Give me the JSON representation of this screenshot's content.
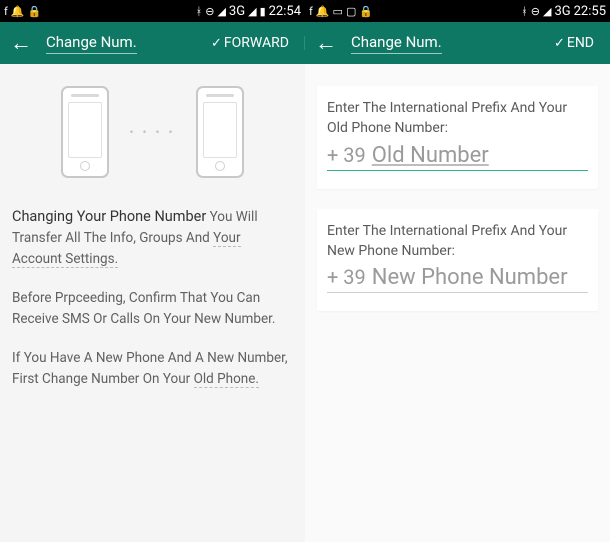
{
  "statusBar": {
    "left": {
      "signal": "3G",
      "time": "22:54"
    },
    "right": {
      "signal": "3G",
      "time": "22:55"
    }
  },
  "header": {
    "left": {
      "title": "Change Num.",
      "action": "FORWARD"
    },
    "right": {
      "title": "Change Num.",
      "action": "END"
    }
  },
  "leftPane": {
    "dots": "• • • •",
    "block1_head": "Changing Your Phone Number",
    "block1_text": "You Will Transfer All The Info, Groups And",
    "block1_tail": "Your Account Settings.",
    "block2_a": "Before Prpceeding, Confirm That You Can",
    "block2_b": "Receive SMS Or Calls On Your New",
    "block2_c": "Number.",
    "block3_a": "If You Have A New Phone And A New",
    "block3_b": "Number, First Change Number On Your",
    "block3_c": "Old Phone."
  },
  "rightPane": {
    "old": {
      "label1": "Enter The International Prefix And Your",
      "label2": "Old Phone Number:",
      "prefix": "+ 39",
      "placeholder": "Old Number"
    },
    "new": {
      "label1": "Enter The International Prefix And Your",
      "label2": "New Phone Number:",
      "prefix": "+ 39",
      "placeholder": "New Phone Number"
    }
  }
}
